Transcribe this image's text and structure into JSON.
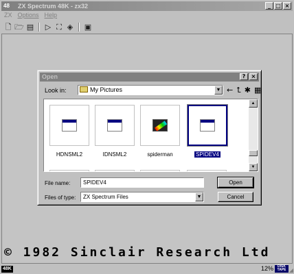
{
  "window": {
    "title": "ZX Spectrum 48K - zx32",
    "app_icon_text": "48"
  },
  "menu": [
    {
      "label": "ZX"
    },
    {
      "label": "Options"
    },
    {
      "label": "Help"
    }
  ],
  "toolbar": {
    "icons": [
      "new-icon",
      "open-icon",
      "save-icon",
      "play-icon",
      "fullscreen-icon",
      "sound-icon",
      "snapshot-icon"
    ]
  },
  "screen": {
    "copyright": "© 1982 Sinclair Research Ltd"
  },
  "status": {
    "model": "48K",
    "percent": "12%",
    "disk": "DISK",
    "tape": "TAPE"
  },
  "dialog": {
    "title": "Open",
    "help_button": "?",
    "close_button": "×",
    "look_in_label": "Look in:",
    "look_in_value": "My Pictures",
    "files": [
      {
        "name": "HDNSML2",
        "icon": "window-file-icon"
      },
      {
        "name": "IDNSML2",
        "icon": "window-file-icon"
      },
      {
        "name": "spiderman",
        "icon": "spectrum-file-icon"
      },
      {
        "name": "SPIDEV4",
        "icon": "window-file-icon",
        "selected": true
      }
    ],
    "file_name_label": "File name:",
    "file_name_value": "SPIDEV4",
    "files_of_type_label": "Files of type:",
    "files_of_type_value": "ZX Spectrum Files",
    "open_button": "Open",
    "cancel_button": "Cancel"
  }
}
